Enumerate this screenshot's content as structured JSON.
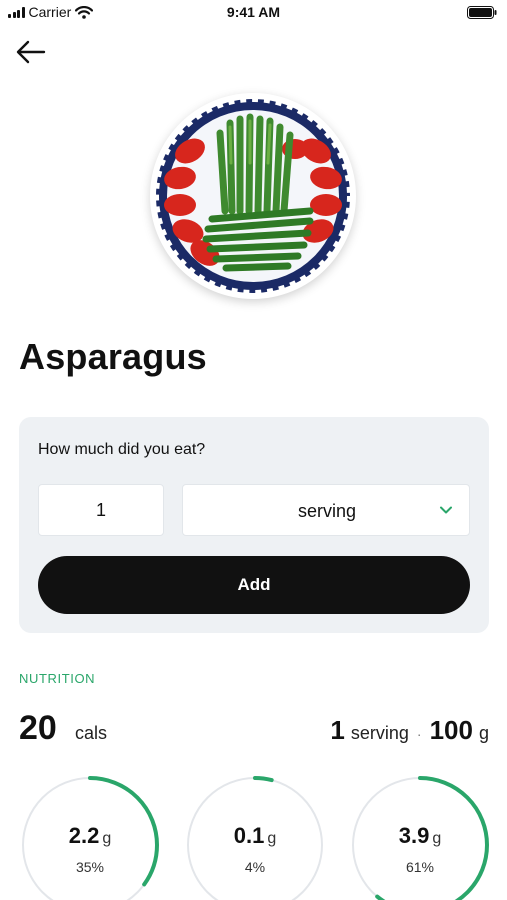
{
  "status_bar": {
    "carrier": "Carrier",
    "time": "9:41 AM"
  },
  "food": {
    "name": "Asparagus"
  },
  "quantity": {
    "question": "How much did you eat?",
    "amount": "1",
    "unit": "serving",
    "add_label": "Add"
  },
  "nutrition": {
    "section_label": "NUTRITION",
    "calories": "20",
    "calories_unit": "cals",
    "serving_count": "1",
    "serving_label": "serving",
    "separator": "·",
    "weight": "100",
    "weight_unit": "g",
    "macros": [
      {
        "value": "2.2",
        "unit": "g",
        "percent_label": "35%",
        "fraction": 0.35
      },
      {
        "value": "0.1",
        "unit": "g",
        "percent_label": "4%",
        "fraction": 0.04
      },
      {
        "value": "3.9",
        "unit": "g",
        "percent_label": "61%",
        "fraction": 0.61
      }
    ]
  },
  "colors": {
    "accent": "#2aa66a",
    "ring_track": "#e3e6ea",
    "button": "#111111",
    "card": "#eef1f4"
  }
}
